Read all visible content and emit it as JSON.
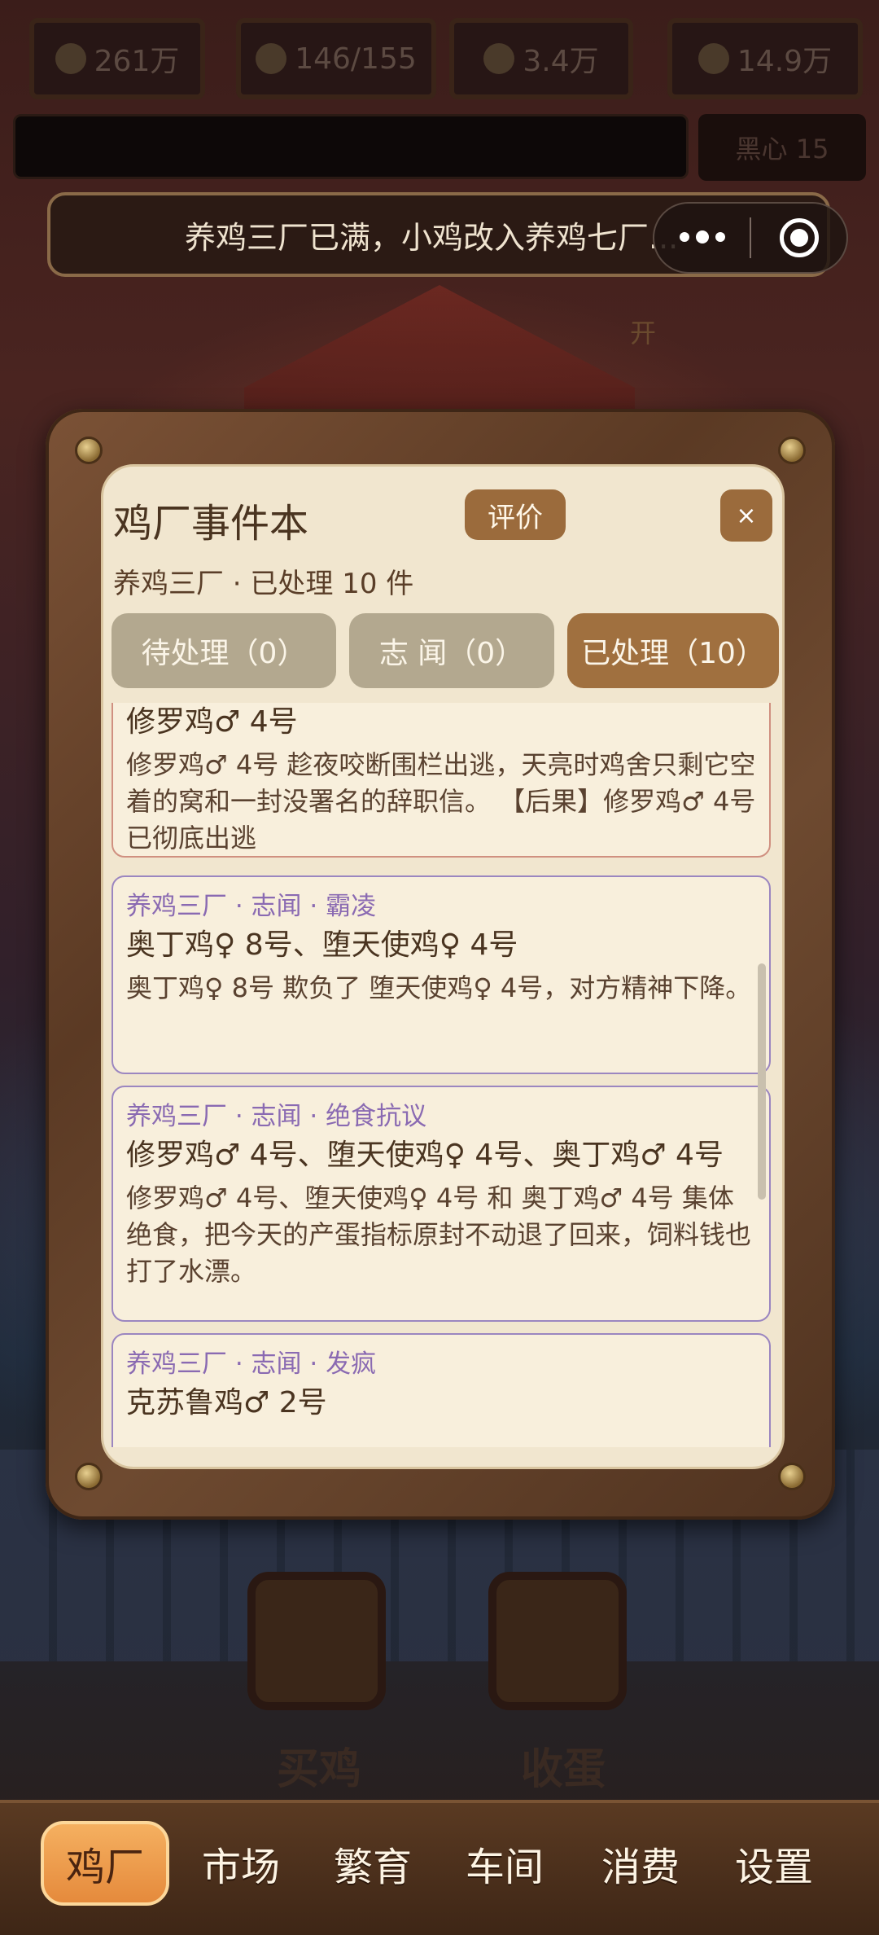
{
  "resources": [
    {
      "icon": "coin-icon",
      "value": "261万"
    },
    {
      "icon": "chicken-icon",
      "value": "146/155"
    },
    {
      "icon": "egg-icon",
      "value": "3.4万"
    },
    {
      "icon": "feed-icon",
      "value": "14.9万"
    }
  ],
  "heart_label": "黑心 15",
  "background_label": "开",
  "toast": {
    "text": "养鸡三厂已满，小鸡改入养鸡七厂..."
  },
  "modal": {
    "title": "鸡厂事件本",
    "rate_label": "评价",
    "close_label": "×",
    "subtitle": "养鸡三厂 · 已处理 10 件",
    "tabs": [
      {
        "label": "待处理（0）",
        "active": false
      },
      {
        "label": "志 闻（0）",
        "active": false
      },
      {
        "label": "已处理（10）",
        "active": true
      }
    ],
    "events": [
      {
        "name": "修罗鸡♂ 4号",
        "desc": "修罗鸡♂ 4号 趁夜咬断围栏出逃，天亮时鸡舍只剩它空着的窝和一封没署名的辞职信。 【后果】修罗鸡♂ 4号 已彻底出逃"
      },
      {
        "tag": "养鸡三厂 · 志闻 · 霸凌",
        "name": "奥丁鸡♀ 8号、堕天使鸡♀ 4号",
        "desc": "奥丁鸡♀ 8号 欺负了 堕天使鸡♀ 4号，对方精神下降。"
      },
      {
        "tag": "养鸡三厂 · 志闻 · 绝食抗议",
        "name": "修罗鸡♂ 4号、堕天使鸡♀ 4号、奥丁鸡♂ 4号",
        "desc": "修罗鸡♂ 4号、堕天使鸡♀ 4号 和 奥丁鸡♂ 4号 集体绝食，把今天的产蛋指标原封不动退了回来，饲料钱也打了水漂。"
      },
      {
        "tag": "养鸡三厂 · 志闻 · 发疯",
        "name": "克苏鲁鸡♂ 2号"
      }
    ]
  },
  "background_actions": [
    {
      "label": "买鸡",
      "icon": "chick-icon"
    },
    {
      "label": "收蛋",
      "icon": "egg-collect-icon"
    }
  ],
  "nav": [
    {
      "label": "鸡厂",
      "active": true
    },
    {
      "label": "市场",
      "active": false
    },
    {
      "label": "繁育",
      "active": false
    },
    {
      "label": "车间",
      "active": false
    },
    {
      "label": "消费",
      "active": false
    },
    {
      "label": "设置",
      "active": false
    }
  ],
  "colors": {
    "accent": "#9b6b3c",
    "nav_active": "#f0a050",
    "tag_purple": "#8a6ab2",
    "card_border_red": "#d09080"
  }
}
